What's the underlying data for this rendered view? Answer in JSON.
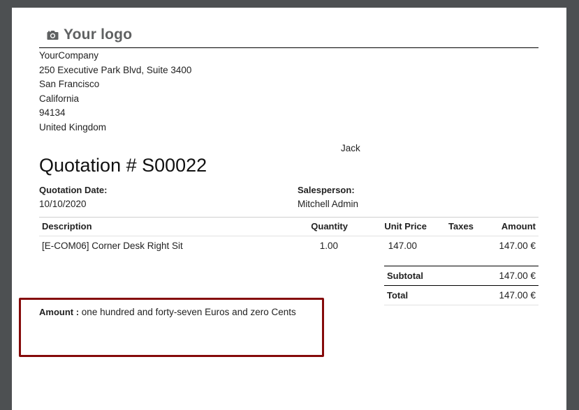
{
  "logo": {
    "text": "Your logo",
    "icon": "camera-icon"
  },
  "company": {
    "name": "YourCompany",
    "street": "250 Executive Park Blvd, Suite 3400",
    "city": "San Francisco",
    "state": "California",
    "zip": "94134",
    "country": "United Kingdom"
  },
  "partner": {
    "name": "Jack"
  },
  "document": {
    "title": "Quotation # S00022"
  },
  "info": {
    "date_label": "Quotation Date:",
    "date_value": "10/10/2020",
    "salesperson_label": "Salesperson:",
    "salesperson_value": "Mitchell Admin"
  },
  "lines": {
    "headers": [
      "Description",
      "Quantity",
      "Unit Price",
      "Taxes",
      "Amount"
    ],
    "rows": [
      {
        "description": "[E-COM06] Corner Desk Right Sit",
        "quantity": "1.00",
        "unit_price": "147.00",
        "taxes": "",
        "amount": "147.00 €"
      }
    ]
  },
  "totals": {
    "subtotal_label": "Subtotal",
    "subtotal_value": "147.00 €",
    "total_label": "Total",
    "total_value": "147.00 €"
  },
  "amount_in_words": {
    "label": "Amount :",
    "text": " one hundred and forty-seven Euros and zero Cents"
  },
  "colors": {
    "highlight_border": "#850a0a",
    "background": "#4d5052",
    "logo_text": "#5f6162"
  }
}
